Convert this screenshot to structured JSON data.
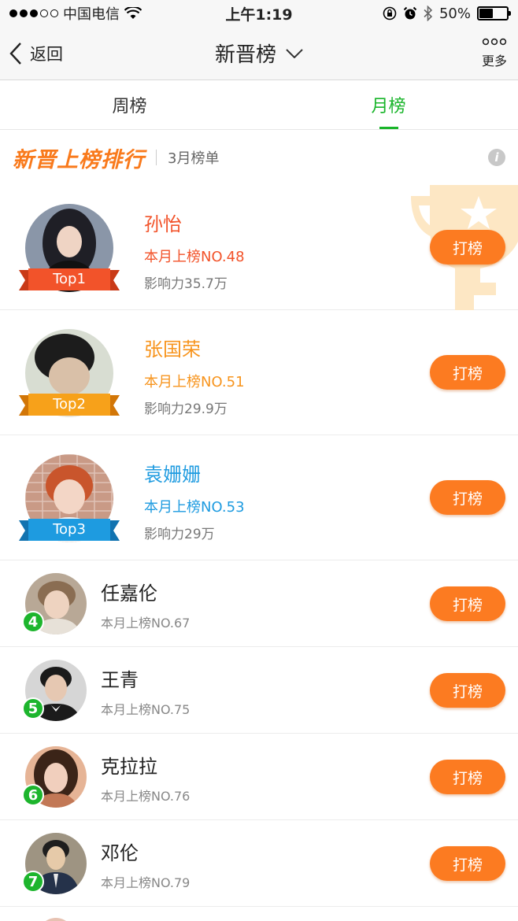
{
  "status_bar": {
    "carrier": "中国电信",
    "time": "上午1:19",
    "battery": "50%"
  },
  "navbar": {
    "back_label": "返回",
    "title": "新晋榜",
    "more_label": "更多"
  },
  "tabs": [
    {
      "label": "周榜",
      "active": false
    },
    {
      "label": "月榜",
      "active": true
    }
  ],
  "section": {
    "title": "新晋上榜排行",
    "subtitle": "3月榜单"
  },
  "button_label": "打榜",
  "top3": [
    {
      "badge": "Top1",
      "name": "孙怡",
      "rank": "本月上榜NO.48",
      "influence": "影响力35.7万",
      "color": "#f2532a"
    },
    {
      "badge": "Top2",
      "name": "张国荣",
      "rank": "本月上榜NO.51",
      "influence": "影响力29.9万",
      "color": "#f7941d"
    },
    {
      "badge": "Top3",
      "name": "袁姗姗",
      "rank": "本月上榜NO.53",
      "influence": "影响力29万",
      "color": "#1e9be0"
    }
  ],
  "list": [
    {
      "num": "4",
      "name": "任嘉伦",
      "rank": "本月上榜NO.67"
    },
    {
      "num": "5",
      "name": "王青",
      "rank": "本月上榜NO.75"
    },
    {
      "num": "6",
      "name": "克拉拉",
      "rank": "本月上榜NO.76"
    },
    {
      "num": "7",
      "name": "邓伦",
      "rank": "本月上榜NO.79"
    }
  ]
}
